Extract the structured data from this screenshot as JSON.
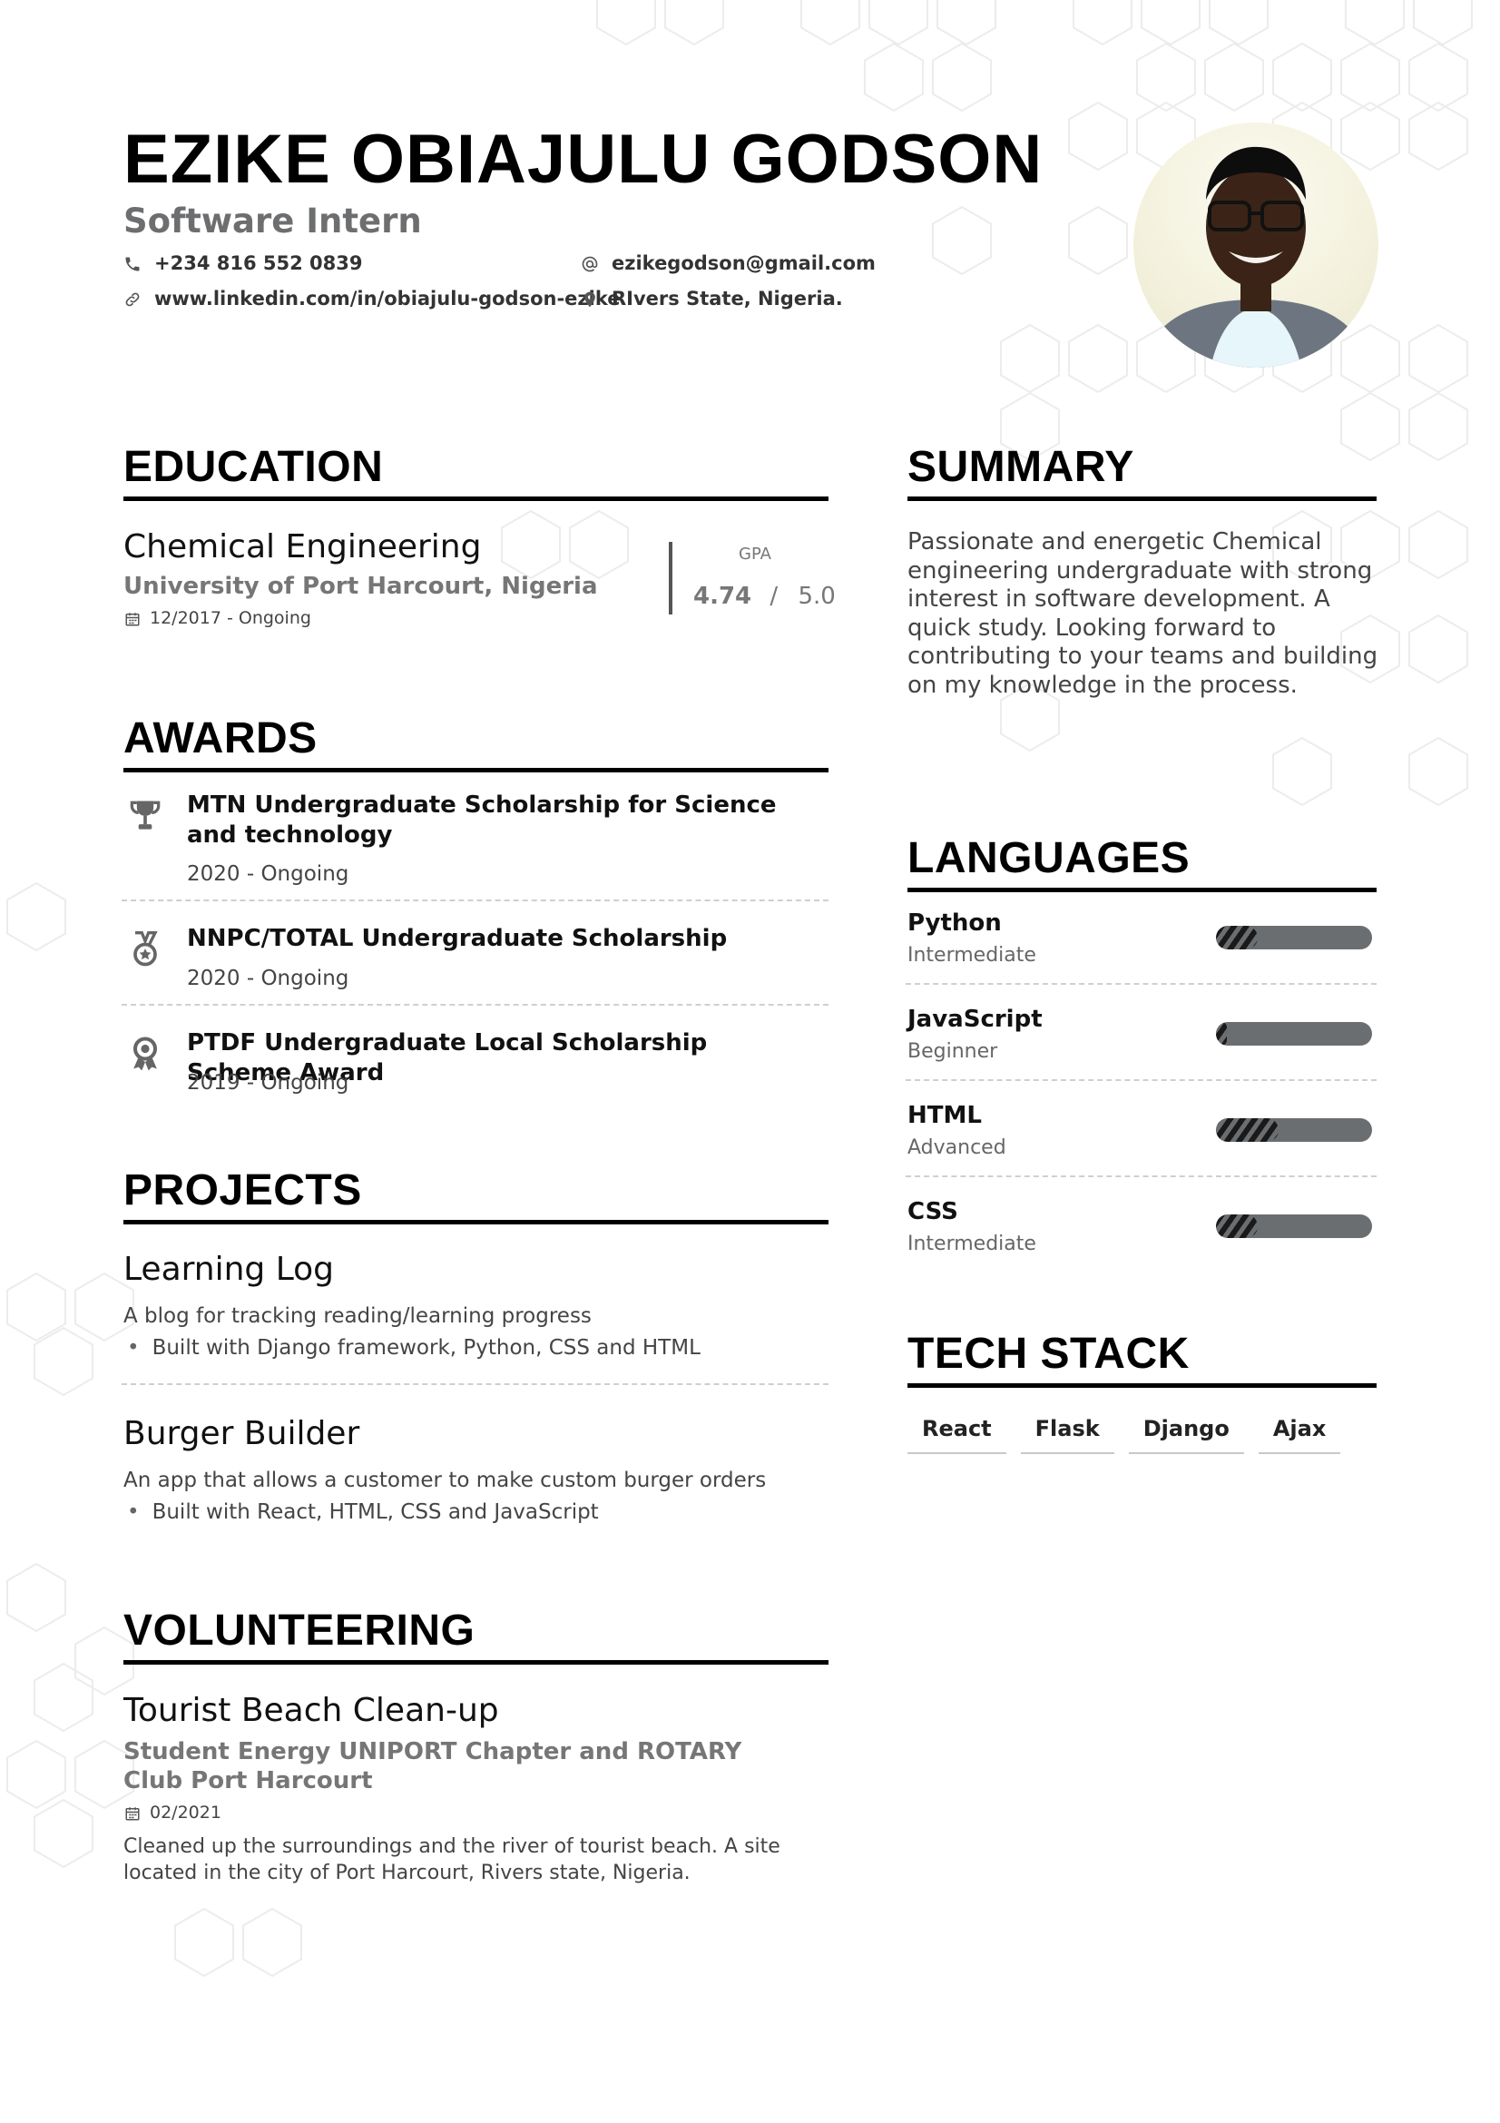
{
  "header": {
    "name": "EZIKE OBIAJULU GODSON",
    "role": "Software Intern",
    "phone": "+234 816 552 0839",
    "email": "ezikegodson@gmail.com",
    "linkedin": "www.linkedin.com/in/obiajulu-godson-ezike",
    "location": "RIvers State, Nigeria."
  },
  "education": {
    "heading": "EDUCATION",
    "degree": "Chemical Engineering",
    "school": "University of Port Harcourt, Nigeria",
    "dates": "12/2017 - Ongoing",
    "gpa_label": "GPA",
    "gpa": "4.74",
    "gpa_sep": "/",
    "gpa_max": "5.0"
  },
  "awards": {
    "heading": "AWARDS",
    "items": [
      {
        "title": "MTN Undergraduate Scholarship for Science and technology",
        "dates": "2020 - Ongoing",
        "icon": "trophy-icon"
      },
      {
        "title": "NNPC/TOTAL Undergraduate Scholarship",
        "dates": "2020 - Ongoing",
        "icon": "medal-icon"
      },
      {
        "title": "PTDF Undergraduate Local Scholarship Scheme Award",
        "dates": "2019 - Ongoing",
        "icon": "ribbon-icon"
      }
    ]
  },
  "projects": {
    "heading": "PROJECTS",
    "items": [
      {
        "title": "Learning Log",
        "desc": "A blog for tracking reading/learning progress",
        "bullet": "Built with Django framework, Python, CSS and HTML"
      },
      {
        "title": "Burger Builder",
        "desc": "An app that allows a customer to make custom burger orders",
        "bullet": "Built with React, HTML, CSS and JavaScript"
      }
    ]
  },
  "volunteering": {
    "heading": "VOLUNTEERING",
    "title": "Tourist Beach Clean-up",
    "org": "Student Energy UNIPORT Chapter and ROTARY Club Port Harcourt",
    "date": "02/2021",
    "desc": "Cleaned up the surroundings and the river of tourist beach. A site located in the city of Port Harcourt, Rivers state, Nigeria."
  },
  "summary": {
    "heading": "SUMMARY",
    "text": "Passionate and energetic Chemical engineering undergraduate with strong interest in software development. A quick study. Looking forward to contributing to your teams and building on my knowledge in the process."
  },
  "languages": {
    "heading": "LANGUAGES",
    "items": [
      {
        "name": "Python",
        "level": "Intermediate",
        "proficiency": 0.27
      },
      {
        "name": "JavaScript",
        "level": "Beginner",
        "proficiency": 0.07
      },
      {
        "name": "HTML",
        "level": "Advanced",
        "proficiency": 0.4
      },
      {
        "name": "CSS",
        "level": "Intermediate",
        "proficiency": 0.27
      }
    ]
  },
  "tech_stack": {
    "heading": "TECH STACK",
    "items": [
      "React",
      "Flask",
      "Django",
      "Ajax"
    ]
  },
  "colors": {
    "heading_rule": "#000000",
    "muted_text": "#767677",
    "bar_track": "#6b6e71"
  }
}
